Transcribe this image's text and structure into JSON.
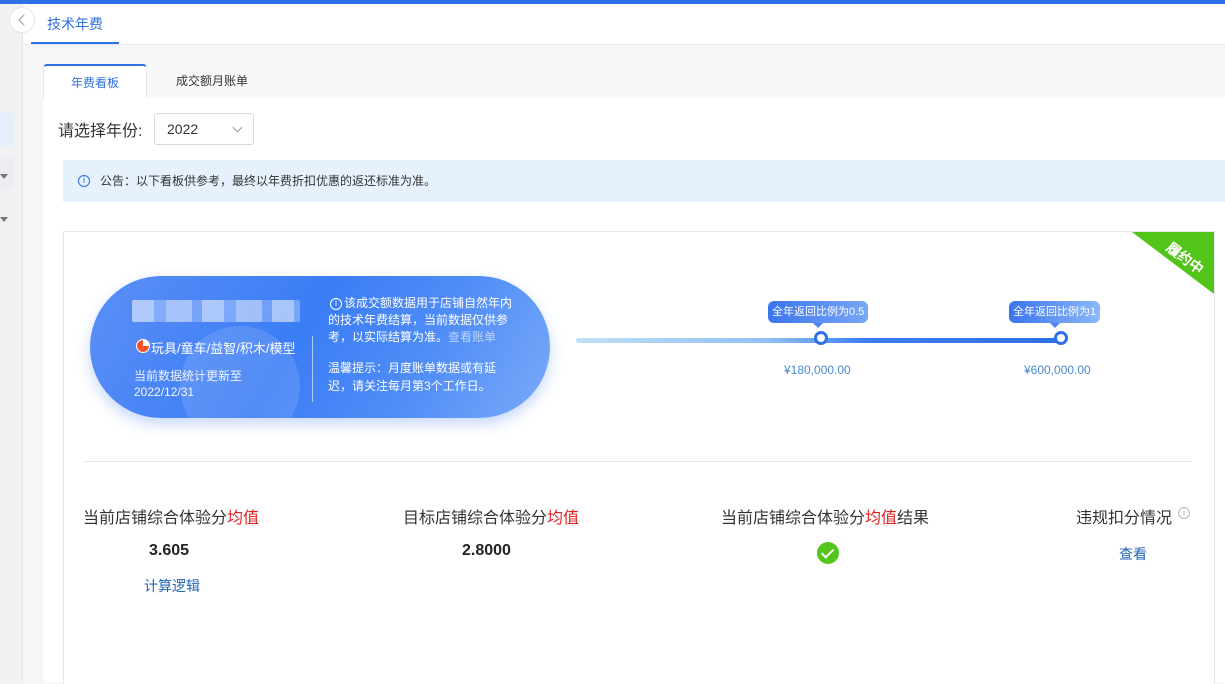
{
  "header": {
    "tab_label": "技术年费"
  },
  "tabs": [
    {
      "label": "年费看板"
    },
    {
      "label": "成交额月账单"
    }
  ],
  "year_filter": {
    "label": "请选择年份:",
    "selected": "2022"
  },
  "notice": {
    "text": "公告：以下看板供参考，最终以年费折扣优惠的返还标准为准。"
  },
  "status_ribbon": {
    "text": "履约中",
    "color": "#52c41a"
  },
  "store_card": {
    "category": "玩具/童车/益智/积木/模型",
    "updated": "当前数据统计更新至2022/12/31",
    "note": "该成交额数据用于店铺自然年内的技术年费结算，当前数据仅供参考，以实际结算为准。",
    "note_link": "查看账单",
    "tip": "温馨提示：月度账单数据或有延迟，请关注每月第3个工作日。"
  },
  "rebate_progress": {
    "milestones": [
      {
        "label": "全年返回比例为0.5",
        "amount": "¥180,000.00"
      },
      {
        "label": "全年返回比例为1",
        "amount": "¥600,000.00"
      }
    ]
  },
  "stats": {
    "current_score": {
      "title_prefix": "当前店铺综合体验分",
      "title_highlight": "均值",
      "value": "3.605",
      "link": "计算逻辑"
    },
    "target_score": {
      "title_prefix": "目标店铺综合体验分",
      "title_highlight": "均值",
      "value": "2.8000"
    },
    "result": {
      "title_prefix": "当前店铺综合体验分",
      "title_highlight": "均值",
      "title_suffix": "结果",
      "status_icon": "check-circle-icon"
    },
    "violation": {
      "title": "违规扣分情况",
      "link": "查看"
    }
  },
  "colors": {
    "primary": "#2f6fe4",
    "success": "#52c41a",
    "highlight": "#e02020",
    "link": "#2066b8"
  }
}
